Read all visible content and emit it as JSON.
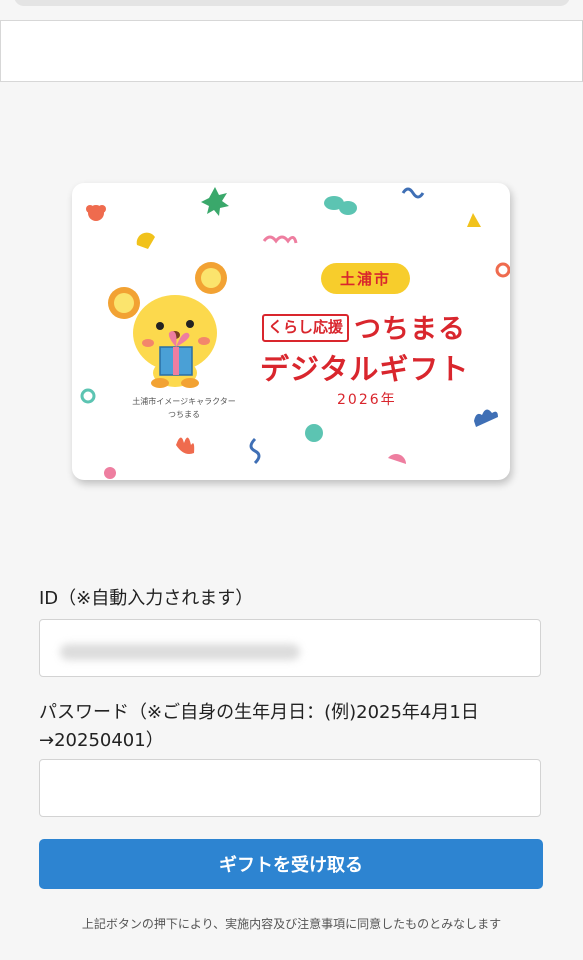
{
  "card": {
    "city": "土浦市",
    "subtitle": "くらし応援",
    "name": "つちまる",
    "title": "デジタルギフト",
    "year": "2026年",
    "mascot_caption_line1": "土浦市イメージキャラクター",
    "mascot_caption_line2": "つちまる"
  },
  "form": {
    "id_label": "ID（※自動入力されます）",
    "id_value": "",
    "password_label_line1": "パスワード（※ご自身の生年月日：(例)2025年4月1日",
    "password_label_line2": "→20250401）",
    "password_value": "",
    "submit_label": "ギフトを受け取る",
    "notice": "上記ボタンの押下により、実施内容及び注意事項に同意したものとみなします"
  },
  "colors": {
    "accent": "#2d84d1",
    "brand_red": "#d9262d",
    "pill_yellow": "#f7cd2c"
  }
}
